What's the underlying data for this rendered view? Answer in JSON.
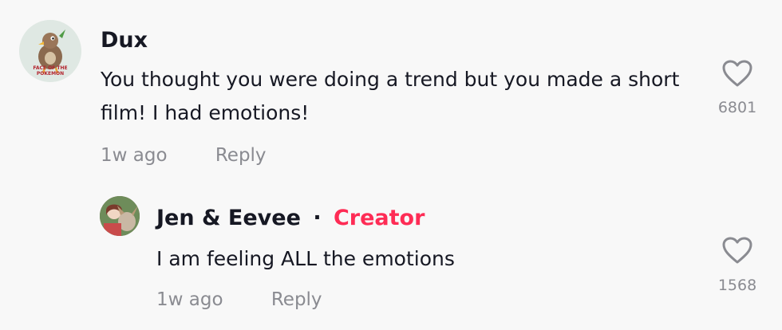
{
  "comments": [
    {
      "author": "Dux",
      "text": "You thought you were doing a trend but you made a short film! I had emotions!",
      "time": "1w ago",
      "reply_label": "Reply",
      "likes": "6801",
      "avatar_icon": "duck-cartoon-avatar",
      "avatar_text": "FACE OF THE POKEMON"
    }
  ],
  "replies": [
    {
      "author": "Jen & Eevee",
      "separator": "·",
      "badge": "Creator",
      "text": "I am feeling ALL the emotions",
      "time": "1w ago",
      "reply_label": "Reply",
      "likes": "1568",
      "avatar_icon": "person-photo-avatar"
    }
  ],
  "colors": {
    "background": "#f8f8f8",
    "text": "#161823",
    "muted": "#8a8b91",
    "creator_badge": "#fe2c55"
  },
  "icons": {
    "like": "heart-outline-icon"
  }
}
